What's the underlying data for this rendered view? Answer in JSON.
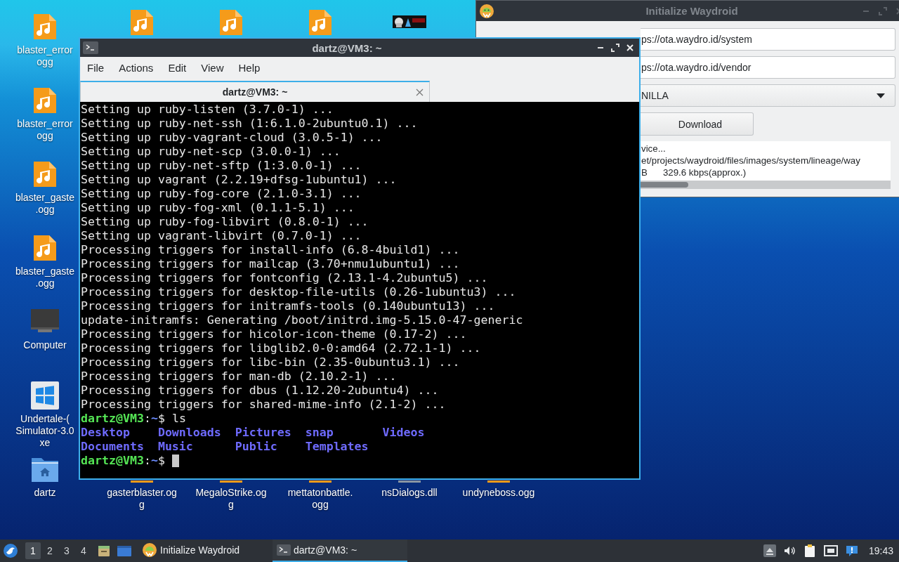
{
  "desktop_icons": [
    {
      "kind": "audio",
      "label": [
        "blaster_error",
        "ogg"
      ]
    },
    {
      "kind": "audio"
    },
    {
      "kind": "audio"
    },
    {
      "kind": "audio"
    },
    {
      "kind": "thumbnail"
    },
    {
      "kind": "audio",
      "label": [
        "blaster_error",
        "ogg"
      ]
    },
    {
      "kind": "audio",
      "label": [
        "blaster_gaste",
        ".ogg"
      ]
    },
    {
      "kind": "audio",
      "label": [
        "blaster_gaste",
        ".ogg"
      ]
    },
    {
      "kind": "computer",
      "label": [
        "Computer"
      ]
    },
    {
      "kind": "exe",
      "label": [
        "Undertale-(",
        "Simulator-3.0",
        "xe"
      ]
    },
    {
      "kind": "folder",
      "label": [
        "dartz"
      ]
    },
    {
      "kind": "audio",
      "label": [
        "gasterblaster.og",
        "g"
      ]
    },
    {
      "kind": "audio",
      "label": [
        "MegaloStrike.og",
        "g"
      ]
    },
    {
      "kind": "audio",
      "label": [
        "mettatonbattle.",
        "ogg"
      ]
    },
    {
      "kind": "file",
      "label": [
        "nsDialogs.dll"
      ]
    },
    {
      "kind": "audio",
      "label": [
        "undyneboss.ogg"
      ]
    }
  ],
  "waydroid_window": {
    "title": "Initialize Waydroid",
    "active": false,
    "system_ota": {
      "value": "ps://ota.waydro.id/system"
    },
    "vendor_ota": {
      "value": "ps://ota.waydro.id/vendor"
    },
    "rom_type": {
      "value": "NILLA"
    },
    "download_button": "Download",
    "log_lines": [
      [
        "vice..."
      ],
      [
        "et/projects/waydroid/files/images/system/lineage/way"
      ],
      [
        "B",
        "329.6 kbps(approx.)"
      ]
    ]
  },
  "terminal_window": {
    "title": "dartz@VM3: ~",
    "active": true,
    "menu": [
      "File",
      "Actions",
      "Edit",
      "View",
      "Help"
    ],
    "tabs": [
      {
        "label": "dartz@VM3: ~",
        "selected": true
      }
    ],
    "lines": [
      {
        "kind": "output",
        "text": "Setting up ruby-listen (3.7.0-1) ..."
      },
      {
        "kind": "output",
        "text": "Setting up ruby-net-ssh (1:6.1.0-2ubuntu0.1) ..."
      },
      {
        "kind": "output",
        "text": "Setting up ruby-vagrant-cloud (3.0.5-1) ..."
      },
      {
        "kind": "output",
        "text": "Setting up ruby-net-scp (3.0.0-1) ..."
      },
      {
        "kind": "output",
        "text": "Setting up ruby-net-sftp (1:3.0.0-1) ..."
      },
      {
        "kind": "output",
        "text": "Setting up vagrant (2.2.19+dfsg-1ubuntu1) ..."
      },
      {
        "kind": "output",
        "text": "Setting up ruby-fog-core (2.1.0-3.1) ..."
      },
      {
        "kind": "output",
        "text": "Setting up ruby-fog-xml (0.1.1-5.1) ..."
      },
      {
        "kind": "output",
        "text": "Setting up ruby-fog-libvirt (0.8.0-1) ..."
      },
      {
        "kind": "output",
        "text": "Setting up vagrant-libvirt (0.7.0-1) ..."
      },
      {
        "kind": "output",
        "text": "Processing triggers for install-info (6.8-4build1) ..."
      },
      {
        "kind": "output",
        "text": "Processing triggers for mailcap (3.70+nmu1ubuntu1) ..."
      },
      {
        "kind": "output",
        "text": "Processing triggers for fontconfig (2.13.1-4.2ubuntu5) ..."
      },
      {
        "kind": "output",
        "text": "Processing triggers for desktop-file-utils (0.26-1ubuntu3) ..."
      },
      {
        "kind": "output",
        "text": "Processing triggers for initramfs-tools (0.140ubuntu13) ..."
      },
      {
        "kind": "output",
        "text": "update-initramfs: Generating /boot/initrd.img-5.15.0-47-generic"
      },
      {
        "kind": "output",
        "text": "Processing triggers for hicolor-icon-theme (0.17-2) ..."
      },
      {
        "kind": "output",
        "text": "Processing triggers for libglib2.0-0:amd64 (2.72.1-1) ..."
      },
      {
        "kind": "output",
        "text": "Processing triggers for libc-bin (2.35-0ubuntu3.1) ..."
      },
      {
        "kind": "output",
        "text": "Processing triggers for man-db (2.10.2-1) ..."
      },
      {
        "kind": "output",
        "text": "Processing triggers for dbus (1.12.20-2ubuntu4) ..."
      },
      {
        "kind": "output",
        "text": "Processing triggers for shared-mime-info (2.1-2) ..."
      },
      {
        "kind": "prompt",
        "user_host": "dartz@VM3",
        "separator": ":",
        "path": "~",
        "symbol": "$",
        "command": "ls",
        "cursor": false
      },
      {
        "kind": "listing",
        "entries": [
          "Desktop",
          "Downloads",
          "Pictures",
          "snap",
          "Videos"
        ]
      },
      {
        "kind": "listing",
        "entries": [
          "Documents",
          "Music",
          "Public",
          "Templates"
        ]
      },
      {
        "kind": "prompt",
        "user_host": "dartz@VM3",
        "separator": ":",
        "path": "~",
        "symbol": "$",
        "cursor": true
      }
    ]
  },
  "taskbar": {
    "workspaces": [
      {
        "label": "1",
        "selected": true
      },
      {
        "label": "2",
        "selected": false
      },
      {
        "label": "3",
        "selected": false
      },
      {
        "label": "4",
        "selected": false
      }
    ],
    "tasks": [
      {
        "kind": "waydroid",
        "label": "Initialize Waydroid",
        "selected": false
      },
      {
        "kind": "terminal",
        "label": "dartz@VM3: ~",
        "selected": true
      }
    ],
    "clock": "19:43"
  }
}
